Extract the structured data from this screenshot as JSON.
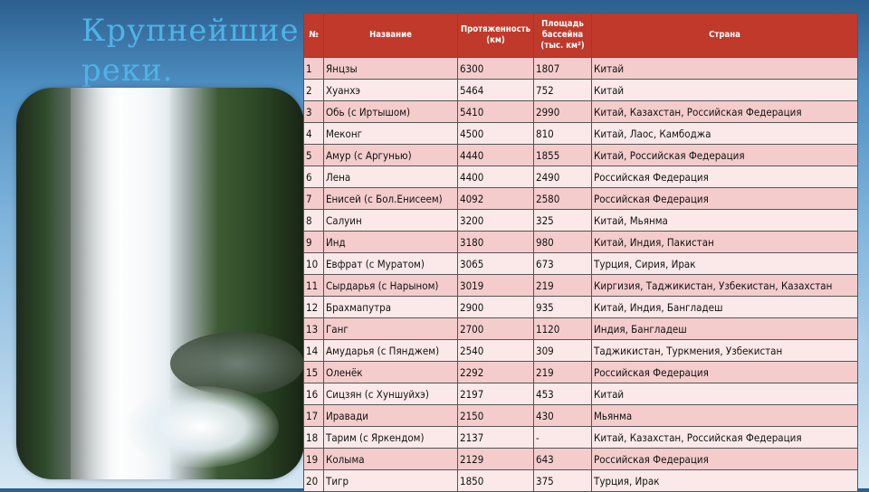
{
  "slide": {
    "title": "Крупнейшие реки."
  },
  "table": {
    "headers": {
      "num": "№",
      "name": "Название",
      "length": "Протяженность (км)",
      "area": "Площадь бассейна (тыс. км²)",
      "country": "Страна"
    },
    "rows": [
      {
        "num": "1",
        "name": "Янцзы",
        "length": "6300",
        "area": "1807",
        "country": "Китай"
      },
      {
        "num": "2",
        "name": "Хуанхэ",
        "length": "5464",
        "area": "752",
        "country": "Китай"
      },
      {
        "num": "3",
        "name": "Обь (с Иртышом)",
        "length": "5410",
        "area": "2990",
        "country": "Китай, Казахстан, Российская Федерация"
      },
      {
        "num": "4",
        "name": "Меконг",
        "length": "4500",
        "area": "810",
        "country": "Китай, Лаос, Камбоджа"
      },
      {
        "num": "5",
        "name": "Амур (с Аргунью)",
        "length": "4440",
        "area": "1855",
        "country": "Китай, Российская Федерация"
      },
      {
        "num": "6",
        "name": "Лена",
        "length": "4400",
        "area": "2490",
        "country": "Российская Федерация"
      },
      {
        "num": "7",
        "name": "Енисей (с Бол.Енисеем)",
        "length": "4092",
        "area": "2580",
        "country": "Российская Федерация"
      },
      {
        "num": "8",
        "name": "Салуин",
        "length": "3200",
        "area": "325",
        "country": "Китай, Мьянма"
      },
      {
        "num": "9",
        "name": "Инд",
        "length": "3180",
        "area": "980",
        "country": "Китай, Индия, Пакистан"
      },
      {
        "num": "10",
        "name": "Евфрат (с Муратом)",
        "length": "3065",
        "area": "673",
        "country": "Турция, Сирия, Ирак"
      },
      {
        "num": "11",
        "name": "Сырдарья (с Нарыном)",
        "length": "3019",
        "area": "219",
        "country": "Киргизия, Таджикистан, Узбекистан, Казахстан"
      },
      {
        "num": "12",
        "name": "Брахмапутра",
        "length": "2900",
        "area": "935",
        "country": "Китай, Индия, Бангладеш"
      },
      {
        "num": "13",
        "name": "Ганг",
        "length": "2700",
        "area": "1120",
        "country": "Индия, Бангладеш"
      },
      {
        "num": "14",
        "name": "Амударья (с Пянджем)",
        "length": "2540",
        "area": "309",
        "country": "Таджикистан, Туркмения, Узбекистан"
      },
      {
        "num": "15",
        "name": "Оленёк",
        "length": "2292",
        "area": "219",
        "country": "Российская Федерация"
      },
      {
        "num": "16",
        "name": "Сицзян (с Хуншуйхэ)",
        "length": "2197",
        "area": "453",
        "country": "Китай"
      },
      {
        "num": "17",
        "name": "Иравади",
        "length": "2150",
        "area": "430",
        "country": "Мьянма"
      },
      {
        "num": "18",
        "name": "Тарим (с Яркендом)",
        "length": "2137",
        "area": "-",
        "country": "Китай, Казахстан, Российская Федерация"
      },
      {
        "num": "19",
        "name": "Колыма",
        "length": "2129",
        "area": "643",
        "country": "Российская Федерация"
      },
      {
        "num": "20",
        "name": "Тигр",
        "length": "1850",
        "area": "375",
        "country": "Турция, Ирак"
      }
    ]
  }
}
